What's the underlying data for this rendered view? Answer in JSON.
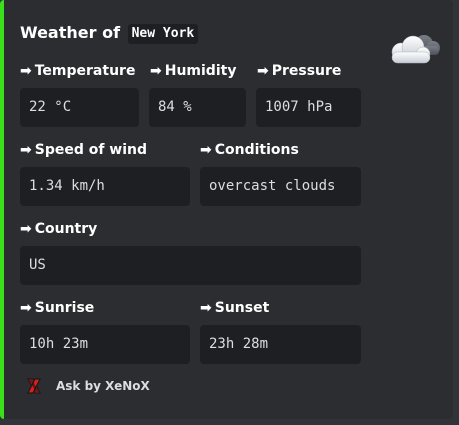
{
  "title": {
    "prefix": "Weather of",
    "city": "New York"
  },
  "thumbnail": {
    "icon": "cloud-sun-icon"
  },
  "fields": {
    "temperature": {
      "label": "Temperature",
      "value": "22 °C"
    },
    "humidity": {
      "label": "Humidity",
      "value": "84 %"
    },
    "pressure": {
      "label": "Pressure",
      "value": "1007 hPa"
    },
    "wind": {
      "label": "Speed of wind",
      "value": "1.34 km/h"
    },
    "conditions": {
      "label": "Conditions",
      "value": "overcast clouds"
    },
    "country": {
      "label": "Country",
      "value": "US"
    },
    "sunrise": {
      "label": "Sunrise",
      "value": "10h 23m"
    },
    "sunset": {
      "label": "Sunset",
      "value": "23h 28m"
    }
  },
  "arrow_glyph": "➡",
  "footer": {
    "text": "Ask by XeNoX",
    "icon": "x-icon"
  },
  "colors": {
    "accent": "#3ae01b",
    "background": "#2b2d31",
    "code_background": "#1e1f22"
  }
}
